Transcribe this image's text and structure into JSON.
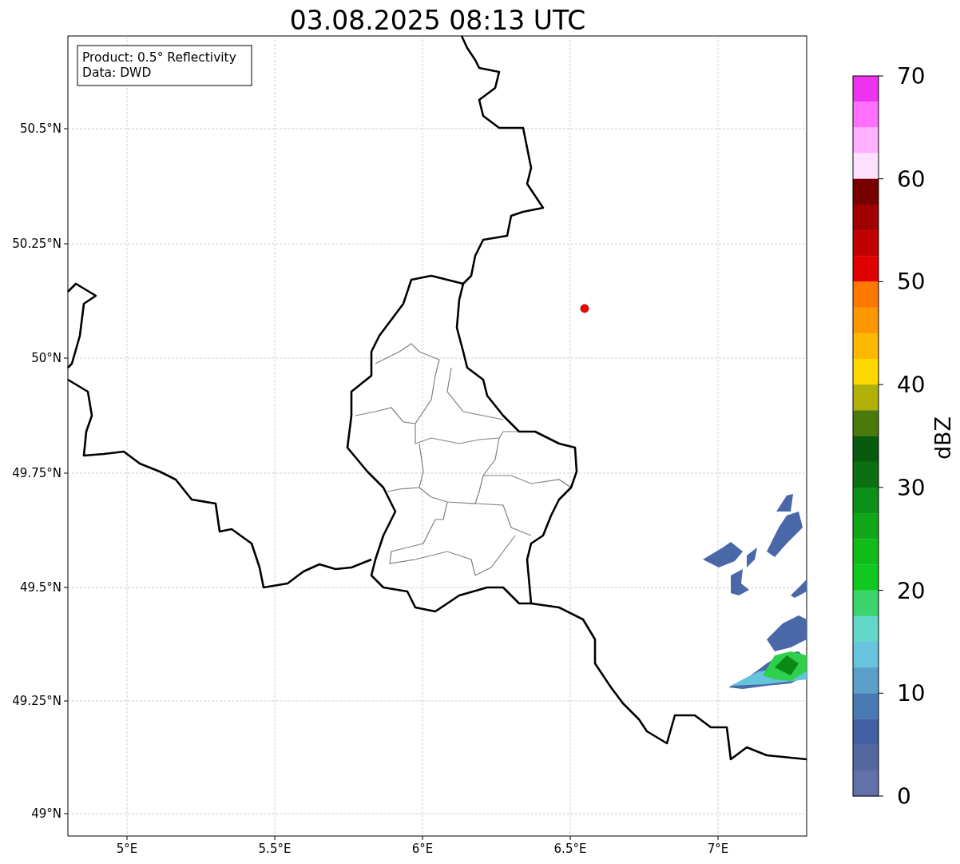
{
  "title": "03.08.2025 08:13 UTC",
  "info_box": [
    "Product: 0.5° Reflectivity",
    "Data: DWD"
  ],
  "map": {
    "x_ticks": [
      "5°E",
      "5.5°E",
      "6°E",
      "6.5°E",
      "7°E"
    ],
    "y_ticks": [
      "50.5°N",
      "50.25°N",
      "50°N",
      "49.75°N",
      "49.5°N",
      "49.25°N",
      "49°N"
    ]
  },
  "colorbar": {
    "label": "dBZ",
    "ticks": [
      "70",
      "60",
      "50",
      "40",
      "30",
      "20",
      "10",
      "0"
    ],
    "bins": [
      {
        "color": "#ee33ee"
      },
      {
        "color": "#ff70ff"
      },
      {
        "color": "#ffb0ff"
      },
      {
        "color": "#ffe0ff"
      },
      {
        "color": "#780000"
      },
      {
        "color": "#a00000"
      },
      {
        "color": "#c00000"
      },
      {
        "color": "#e00000"
      },
      {
        "color": "#ff7800"
      },
      {
        "color": "#ff9800"
      },
      {
        "color": "#ffb800"
      },
      {
        "color": "#ffd800"
      },
      {
        "color": "#b0b008"
      },
      {
        "color": "#4a7a0c"
      },
      {
        "color": "#085a0c"
      },
      {
        "color": "#0a7010"
      },
      {
        "color": "#0c9018"
      },
      {
        "color": "#10a818"
      },
      {
        "color": "#10bc18"
      },
      {
        "color": "#10c820"
      },
      {
        "color": "#3cd46c"
      },
      {
        "color": "#64d8c8"
      },
      {
        "color": "#68c4dc"
      },
      {
        "color": "#5aa0c8"
      },
      {
        "color": "#4a7ab4"
      },
      {
        "color": "#4460a4"
      },
      {
        "color": "#5468a0"
      },
      {
        "color": "#6272a8"
      }
    ]
  }
}
